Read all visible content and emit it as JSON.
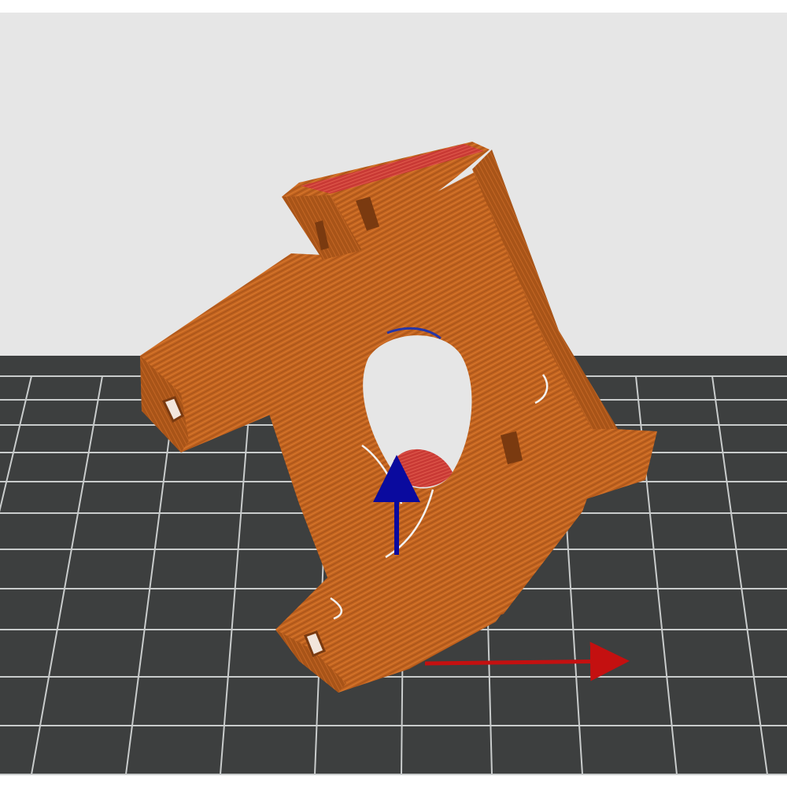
{
  "viewport": {
    "background_color": "#e6e6e6",
    "frame_color": "#ffffff",
    "bed": {
      "color": "#3d3f3f",
      "grid_line_color": "#c9cccc"
    }
  },
  "model": {
    "type": "sliced-part-preview",
    "color": "#c0621f",
    "highlight_color": "#d8782c",
    "shadow_color": "#8d4514",
    "top_surface_color": "#c93a35",
    "seam_color": "#f3f3f3",
    "inner_edge_color": "#2535a6"
  },
  "axes": {
    "x_axis": {
      "icon": "x-axis-arrow-icon",
      "color": "#c41010"
    },
    "z_axis": {
      "icon": "z-axis-arrow-icon",
      "color": "#0a0a9e"
    }
  }
}
